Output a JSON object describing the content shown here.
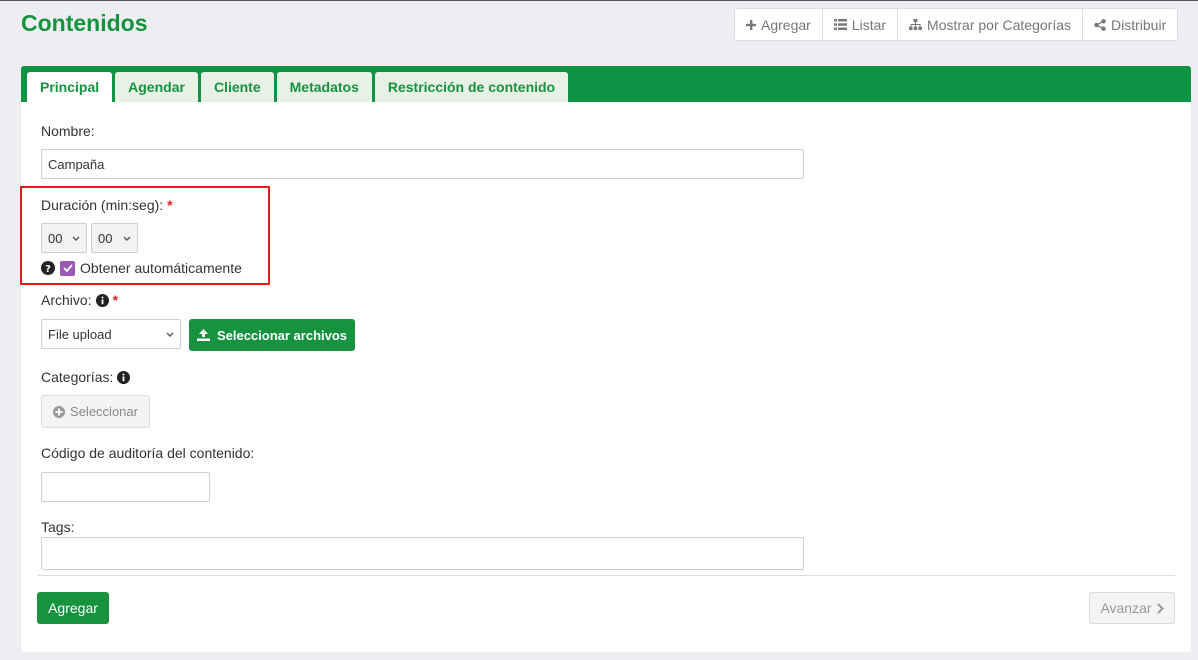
{
  "page": {
    "title": "Contenidos"
  },
  "toolbar": {
    "add": "Agregar",
    "list": "Listar",
    "categories": "Mostrar por Categorías",
    "distribute": "Distribuir"
  },
  "tabs": [
    "Principal",
    "Agendar",
    "Cliente",
    "Metadatos",
    "Restricción de contenido"
  ],
  "form": {
    "nombre_label": "Nombre:",
    "nombre_value": "Campaña",
    "duracion_label": "Duración (min:seg):",
    "required_mark": "*",
    "duracion_min": "00",
    "duracion_seg": "00",
    "auto_label": "Obtener automáticamente",
    "archivo_label": "Archivo:",
    "archivo_select": "File upload",
    "select_files": "Seleccionar archivos",
    "categorias_label": "Categorías:",
    "seleccionar": "Seleccionar",
    "auditoria_label": "Código de auditoría del contenido:",
    "auditoria_value": "",
    "tags_label": "Tags:",
    "tags_value": ""
  },
  "footer": {
    "submit": "Agregar",
    "next": "Avanzar"
  },
  "colors": {
    "brand_green": "#17923f",
    "tab_bar": "#0f9446",
    "highlight": "#e01b1b",
    "checkbox": "#9b59b6"
  }
}
